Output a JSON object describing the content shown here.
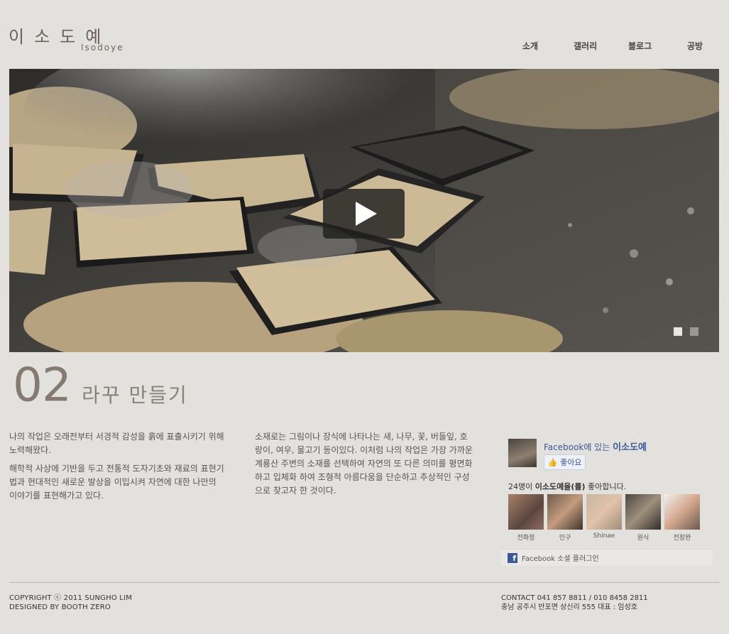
{
  "logo": {
    "korean": "이소도예",
    "english": "Isodoye"
  },
  "nav": [
    {
      "label": "소개"
    },
    {
      "label": "갤러리"
    },
    {
      "label": "블로그"
    },
    {
      "label": "공방"
    }
  ],
  "hero": {
    "slide_count": 2,
    "active_slide": 1,
    "play_icon": "play-icon"
  },
  "section": {
    "number": "02",
    "title": "라꾸 만들기"
  },
  "content": {
    "col1": [
      "나의 작업은 오래전부터 서경적 감성을 흙에 표출시키기 위해 노력해왔다.",
      "해학적 사상에 기반을 두고 전통적 도자기초와 재료의 표현기법과 현대적인 새로운 발상을 이입시켜 자연에 대한 나만의 이야기를 표현해가고 있다."
    ],
    "col2": [
      "소재로는 그림이나 장식에 나타나는 새, 나무, 꽃, 버들잎, 호랑이, 여우, 물고기 등이있다. 이처럼 나의 작업은 가장 가까운 계룡산 주변의 소재를 선택하여 자연의 또 다른 의미를 평면화하고 입체화 하여 조형적 아름다움을 단순하고 추상적인 구성으로 찾고자 한 것이다."
    ]
  },
  "facebook": {
    "page_prefix": "Facebook에 있는",
    "page_name": "이소도예",
    "like_label": "좋아요",
    "count_prefix": "24명이",
    "count_name": "이소도예을(를)",
    "count_suffix": "좋아합니다.",
    "fans": [
      {
        "name": "전화정"
      },
      {
        "name": "인구"
      },
      {
        "name": "Shinae"
      },
      {
        "name": "원식"
      },
      {
        "name": "전창완"
      }
    ],
    "footer": "Facebook 소셜 플러그인",
    "brand_color": "#3b5998"
  },
  "footer": {
    "copyright": "COPYRIGHT ⓒ 2011 SUNGHO LIM",
    "designed": "DESIGNED BY BOOTH ZERO",
    "contact": "CONTACT 041 857 8811 / 010 8458 2811",
    "address": "충남 공주시 반포면 상신리 555 대표 : 임성호"
  }
}
